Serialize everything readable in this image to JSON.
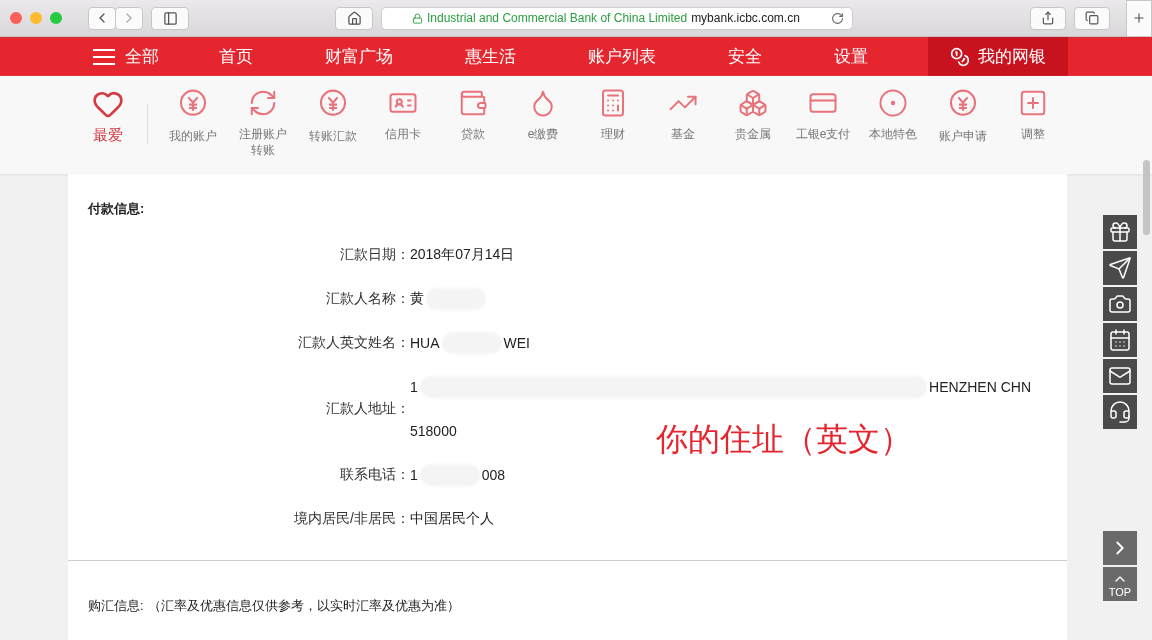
{
  "browser": {
    "site_org": "Industrial and Commercial Bank of China Limited",
    "site_domain": "mybank.icbc.com.cn"
  },
  "nav": {
    "menu_label": "全部",
    "items": [
      {
        "label": "首页",
        "selected": false
      },
      {
        "label": "财富广场",
        "selected": false
      },
      {
        "label": "惠生活",
        "selected": false
      },
      {
        "label": "账户列表",
        "selected": false
      },
      {
        "label": "安全",
        "selected": false
      },
      {
        "label": "设置",
        "selected": false
      },
      {
        "label": "我的网银",
        "selected": true
      }
    ]
  },
  "shortcuts": {
    "favorite": "最爱",
    "items": [
      {
        "label": "我的账户"
      },
      {
        "label": "注册账户转账"
      },
      {
        "label": "转账汇款"
      },
      {
        "label": "信用卡"
      },
      {
        "label": "贷款"
      },
      {
        "label": "e缴费"
      },
      {
        "label": "理财"
      },
      {
        "label": "基金"
      },
      {
        "label": "贵金属"
      },
      {
        "label": "工银e支付"
      },
      {
        "label": "本地特色"
      },
      {
        "label": "账户申请"
      },
      {
        "label": "调整"
      }
    ]
  },
  "payment": {
    "title": "付款信息:",
    "rows": [
      {
        "label": "汇款日期：",
        "lines": [
          [
            {
              "kind": "text",
              "text": "2018年07月14日"
            }
          ]
        ]
      },
      {
        "label": "汇款人名称：",
        "lines": [
          [
            {
              "kind": "text",
              "text": "黄"
            },
            {
              "kind": "redacted"
            }
          ]
        ]
      },
      {
        "label": "汇款人英文姓名：",
        "lines": [
          [
            {
              "kind": "text",
              "text": "HUA"
            },
            {
              "kind": "redacted"
            },
            {
              "kind": "text",
              "text": "WEI"
            }
          ]
        ]
      },
      {
        "label": "汇款人地址：",
        "lines": [
          [
            {
              "kind": "text",
              "text": "1"
            },
            {
              "kind": "redacted"
            },
            {
              "kind": "text",
              "text": "HENZHEN CHN"
            }
          ],
          [
            {
              "kind": "text",
              "text": "518000"
            }
          ]
        ],
        "note": "你的住址（英文）"
      },
      {
        "label": "联系电话：",
        "lines": [
          [
            {
              "kind": "text",
              "text": "1"
            },
            {
              "kind": "redacted"
            },
            {
              "kind": "text",
              "text": "008"
            }
          ]
        ]
      },
      {
        "label": "境内居民/非居民：",
        "lines": [
          [
            {
              "kind": "text",
              "text": "中国居民个人"
            }
          ]
        ]
      }
    ]
  },
  "exchange": {
    "title": "购汇信息:",
    "note": "（汇率及优惠信息仅供参考，以实时汇率及优惠为准）"
  },
  "float_bar": {
    "top_label": "TOP"
  }
}
